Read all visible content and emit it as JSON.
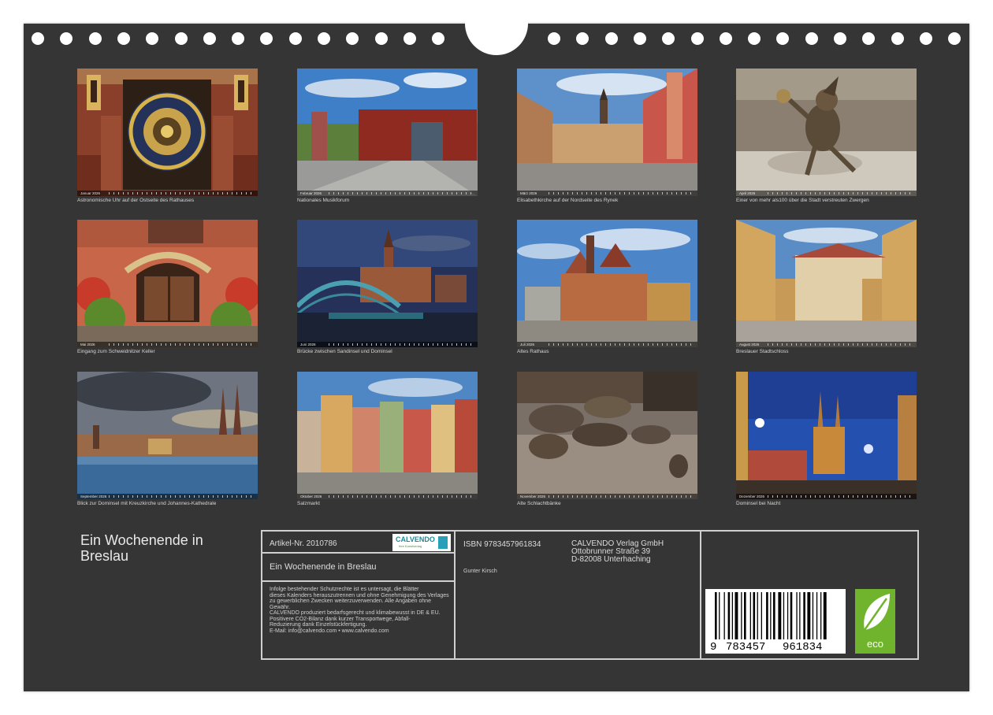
{
  "photos": [
    {
      "month": "Januar 2026",
      "caption": "Astronomische Uhr auf der Ostseite des Rathauses"
    },
    {
      "month": "Februar 2026",
      "caption": "Nationales Musikforum"
    },
    {
      "month": "März 2026",
      "caption": "Elisabethkirche auf der Nordseite des Rynek"
    },
    {
      "month": "April 2026",
      "caption": "Einer von mehr als100 über die Stadt verstreuten Zwergen"
    },
    {
      "month": "Mai 2026",
      "caption": "Eingang zum Schweidnitzer Keller"
    },
    {
      "month": "Juni 2026",
      "caption": "Brücke zwischen Sandinsel und Dominsel"
    },
    {
      "month": "Juli 2026",
      "caption": "Altes Rathaus"
    },
    {
      "month": "August 2026",
      "caption": "Breslauer Stadtschloss"
    },
    {
      "month": "September 2026",
      "caption": "Blick zur Dominsel mit Kreuzkirche und Johannes-Kathedrale"
    },
    {
      "month": "Oktober 2026",
      "caption": "Salzmarkt"
    },
    {
      "month": "November 2026",
      "caption": "Alte Schlachtbänke"
    },
    {
      "month": "Dezember 2026",
      "caption": "Dominsel bei Nacht"
    }
  ],
  "title": "Ein Wochenende in Breslau",
  "info": {
    "article": "Artikel-Nr. 2010786",
    "calvendo_logo": "CALVENDO",
    "calvendo_sub": "Ihre Kunstverlag",
    "box_title": "Ein Wochenende in Breslau",
    "legal": [
      "Infolge bestehender Schutzrechte ist es untersagt, die Blätter",
      "dieses Kalenders herauszutrennen und ohne Genehmigung des Verlages",
      "zu gewerblichen Zwecken weiterzuverwenden. Alle Angaben ohne",
      "Gewähr.",
      "CALVENDO produziert bedarfsgerecht und klimabewusst in DE & EU.",
      "Positivere CO2-Bilanz dank kurzer Transportwege, Abfall-",
      "Reduzierung dank Einzelstückfertigung.",
      "E-Mail: info@calvendo.com • www.calvendo.com"
    ],
    "isbn": "ISBN 9783457961834",
    "author": "Gunter Kirsch",
    "publisher_lines": [
      "CALVENDO Verlag GmbH",
      "Ottobrunner Straße 39",
      "D-82008 Unterhaching"
    ],
    "barcode_digits": [
      "9",
      "783457",
      "961834"
    ],
    "eco_label": "eco"
  },
  "colors": {
    "background": "#353535",
    "text": "#e9e9e9",
    "eco_green": "#6fb42c"
  }
}
